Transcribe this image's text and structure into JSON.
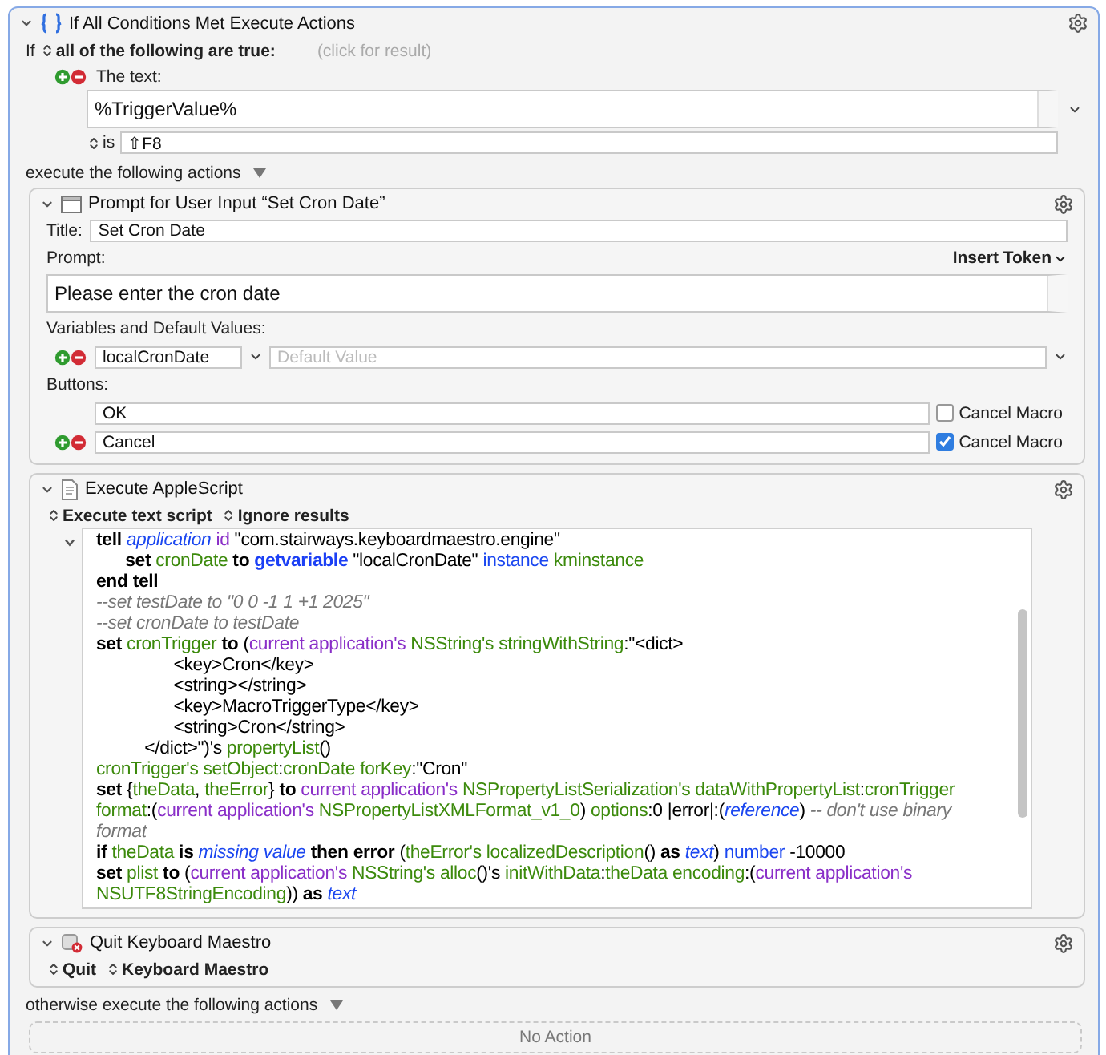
{
  "group": {
    "title": "If All Conditions Met Execute Actions",
    "expanded": true,
    "condition": {
      "prefix": "If",
      "mode": "all of the following are true:",
      "hint": "(click for result)"
    },
    "conditions": [
      {
        "label": "The text:",
        "value": "%TriggerValue%",
        "operator": "is",
        "operand": "⇧F8"
      }
    ],
    "then_label": "execute the following actions",
    "actions": [
      {
        "kind": "prompt",
        "expanded": true,
        "title": "Prompt for User Input “Set Cron Date”",
        "title_label": "Title:",
        "title_value": "Set Cron Date",
        "prompt_label": "Prompt:",
        "insert_token": "Insert Token",
        "prompt_value": "Please enter the cron date",
        "variables_label": "Variables and Default Values:",
        "variables": [
          {
            "name": "localCronDate",
            "placeholder": "Default Value"
          }
        ],
        "buttons_label": "Buttons:",
        "buttons": [
          {
            "label": "OK",
            "cancel_label": "Cancel Macro",
            "cancel_checked": false
          },
          {
            "label": "Cancel",
            "cancel_label": "Cancel Macro",
            "cancel_checked": true
          }
        ]
      },
      {
        "kind": "applescript",
        "expanded": true,
        "title": "Execute AppleScript",
        "options": [
          "Execute text script",
          "Ignore results"
        ],
        "code": [
          [
            {
              "kind": "kw",
              "text": "tell "
            },
            {
              "kind": "cls",
              "text": "application"
            },
            {
              "kind": "prop",
              "text": " id"
            },
            {
              "kind": "plain",
              "text": " \"com.stairways.keyboardmaestro.engine\""
            }
          ],
          [
            {
              "kind": "kw",
              "text": "      set "
            },
            {
              "kind": "var",
              "text": "cronDate"
            },
            {
              "kind": "kw",
              "text": " to "
            },
            {
              "kind": "cmd",
              "text": "getvariable"
            },
            {
              "kind": "plain",
              "text": " \"localCronDate\" "
            },
            {
              "kind": "param",
              "text": "instance"
            },
            {
              "kind": "var",
              "text": " kminstance"
            }
          ],
          [
            {
              "kind": "kw",
              "text": "end tell"
            }
          ],
          [
            {
              "kind": "comment",
              "text": "--set testDate to \"0 0 -1 1 +1 2025\""
            }
          ],
          [
            {
              "kind": "comment",
              "text": "--set cronDate to testDate"
            }
          ],
          [
            {
              "kind": "kw",
              "text": "set "
            },
            {
              "kind": "var",
              "text": "cronTrigger"
            },
            {
              "kind": "kw",
              "text": " to "
            },
            {
              "kind": "plain",
              "text": "("
            },
            {
              "kind": "prop",
              "text": "current application's "
            },
            {
              "kind": "var",
              "text": "NSString's stringWithString"
            },
            {
              "kind": "plain",
              "text": ":\"<dict>"
            }
          ],
          [
            {
              "kind": "plain",
              "text": "                <key>Cron</key>"
            }
          ],
          [
            {
              "kind": "plain",
              "text": "                <string></string>"
            }
          ],
          [
            {
              "kind": "plain",
              "text": "                <key>MacroTriggerType</key>"
            }
          ],
          [
            {
              "kind": "plain",
              "text": "                <string>Cron</string>"
            }
          ],
          [
            {
              "kind": "plain",
              "text": "          </dict>\")'s "
            },
            {
              "kind": "var",
              "text": "propertyList"
            },
            {
              "kind": "plain",
              "text": "()"
            }
          ],
          [
            {
              "kind": "var",
              "text": "cronTrigger's setObject"
            },
            {
              "kind": "plain",
              "text": ":"
            },
            {
              "kind": "var",
              "text": "cronDate forKey"
            },
            {
              "kind": "plain",
              "text": ":\"Cron\""
            }
          ],
          [
            {
              "kind": "kw",
              "text": "set "
            },
            {
              "kind": "plain",
              "text": "{"
            },
            {
              "kind": "var",
              "text": "theData"
            },
            {
              "kind": "plain",
              "text": ", "
            },
            {
              "kind": "var",
              "text": "theError"
            },
            {
              "kind": "plain",
              "text": "} "
            },
            {
              "kind": "kw",
              "text": "to "
            },
            {
              "kind": "prop",
              "text": "current application's "
            },
            {
              "kind": "var",
              "text": "NSPropertyListSerialization's dataWithPropertyList"
            },
            {
              "kind": "plain",
              "text": ":"
            },
            {
              "kind": "var",
              "text": "cronTrigger"
            }
          ],
          [
            {
              "kind": "var",
              "text": "format"
            },
            {
              "kind": "plain",
              "text": ":("
            },
            {
              "kind": "prop",
              "text": "current application's "
            },
            {
              "kind": "var",
              "text": "NSPropertyListXMLFormat_v1_0"
            },
            {
              "kind": "plain",
              "text": ") "
            },
            {
              "kind": "var",
              "text": "options"
            },
            {
              "kind": "plain",
              "text": ":0 |error|:("
            },
            {
              "kind": "cls",
              "text": "reference"
            },
            {
              "kind": "plain",
              "text": ") "
            },
            {
              "kind": "comment",
              "text": "-- don't use binary"
            }
          ],
          [
            {
              "kind": "comment",
              "text": "format"
            }
          ],
          [
            {
              "kind": "kw",
              "text": "if "
            },
            {
              "kind": "var",
              "text": "theData"
            },
            {
              "kind": "kw",
              "text": " is "
            },
            {
              "kind": "cls",
              "text": "missing value"
            },
            {
              "kind": "kw",
              "text": " then error "
            },
            {
              "kind": "plain",
              "text": "("
            },
            {
              "kind": "var",
              "text": "theError's localizedDescription"
            },
            {
              "kind": "plain",
              "text": "() "
            },
            {
              "kind": "kw",
              "text": "as "
            },
            {
              "kind": "cls",
              "text": "text"
            },
            {
              "kind": "plain",
              "text": ") "
            },
            {
              "kind": "param",
              "text": "number"
            },
            {
              "kind": "plain",
              "text": " -10000"
            }
          ],
          [
            {
              "kind": "kw",
              "text": "set "
            },
            {
              "kind": "var",
              "text": "plist"
            },
            {
              "kind": "kw",
              "text": " to "
            },
            {
              "kind": "plain",
              "text": "("
            },
            {
              "kind": "prop",
              "text": "current application's "
            },
            {
              "kind": "var",
              "text": "NSString's alloc"
            },
            {
              "kind": "plain",
              "text": "()'s "
            },
            {
              "kind": "var",
              "text": "initWithData"
            },
            {
              "kind": "plain",
              "text": ":"
            },
            {
              "kind": "var",
              "text": "theData encoding"
            },
            {
              "kind": "plain",
              "text": ":("
            },
            {
              "kind": "prop",
              "text": "current application's"
            }
          ],
          [
            {
              "kind": "var",
              "text": "NSUTF8StringEncoding"
            },
            {
              "kind": "plain",
              "text": ")) "
            },
            {
              "kind": "kw",
              "text": "as "
            },
            {
              "kind": "cls",
              "text": "text"
            }
          ]
        ]
      },
      {
        "kind": "quit",
        "expanded": true,
        "title": "Quit Keyboard Maestro",
        "options": [
          "Quit",
          "Keyboard Maestro"
        ]
      }
    ],
    "else_label": "otherwise execute the following actions",
    "else_empty": "No Action"
  }
}
